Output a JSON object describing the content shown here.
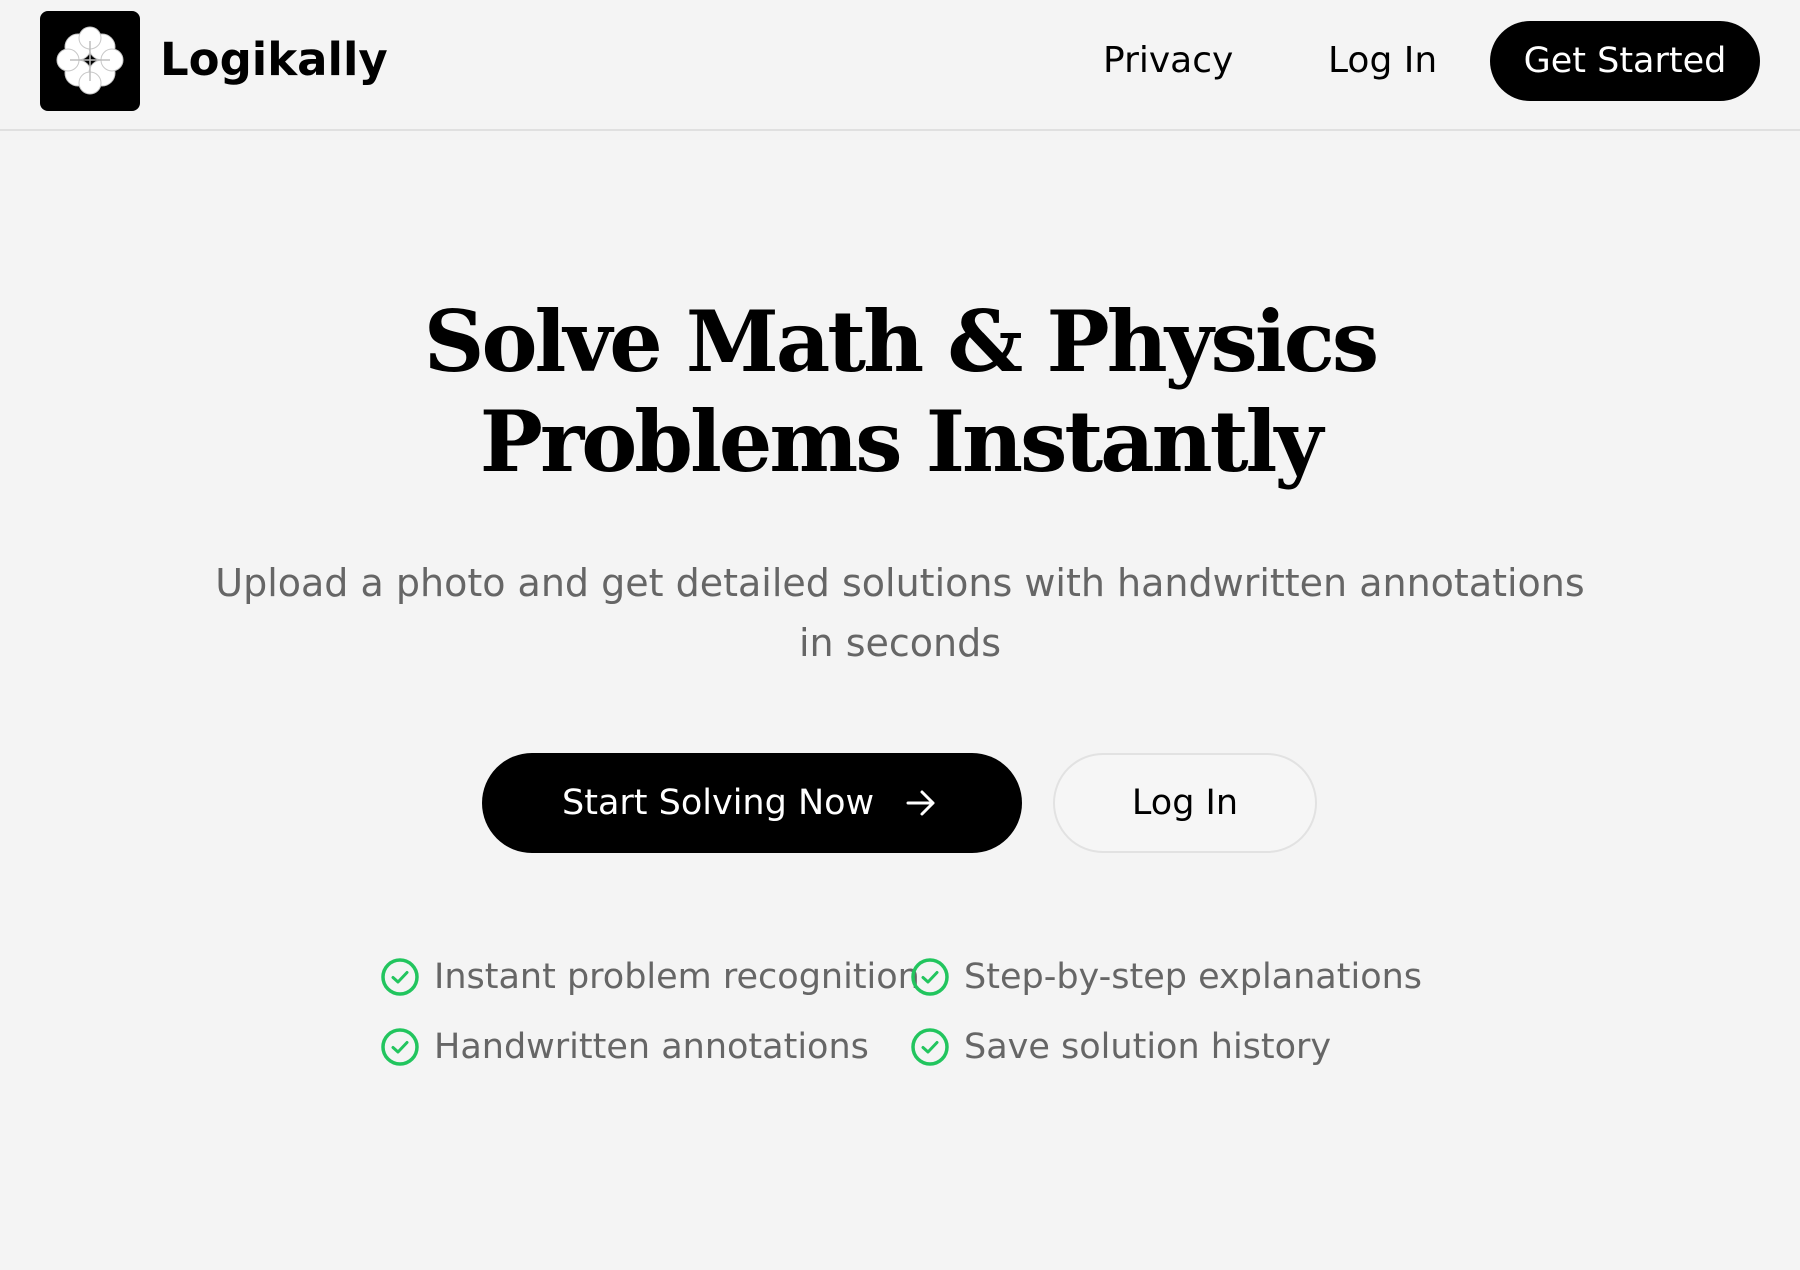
{
  "header": {
    "brand": "Logikally",
    "logo_icon": "clover-icon",
    "nav": {
      "privacy": "Privacy",
      "login": "Log In",
      "get_started": "Get Started"
    }
  },
  "hero": {
    "title_line1": "Solve Math & Physics",
    "title_line2": "Problems Instantly",
    "subtitle_line1": "Upload a photo and get detailed solutions with handwritten annotations",
    "subtitle_line2": "in seconds",
    "primary_button": "Start Solving Now",
    "primary_button_icon": "arrow-right-icon",
    "secondary_button": "Log In"
  },
  "features": [
    {
      "label": "Instant problem recognition",
      "icon": "check-circle-icon"
    },
    {
      "label": "Step-by-step explanations",
      "icon": "check-circle-icon"
    },
    {
      "label": "Handwritten annotations",
      "icon": "check-circle-icon"
    },
    {
      "label": "Save solution history",
      "icon": "check-circle-icon"
    }
  ],
  "colors": {
    "background": "#f4f4f4",
    "primary": "#000000",
    "muted_text": "#666666",
    "check_green": "#22c55e"
  }
}
